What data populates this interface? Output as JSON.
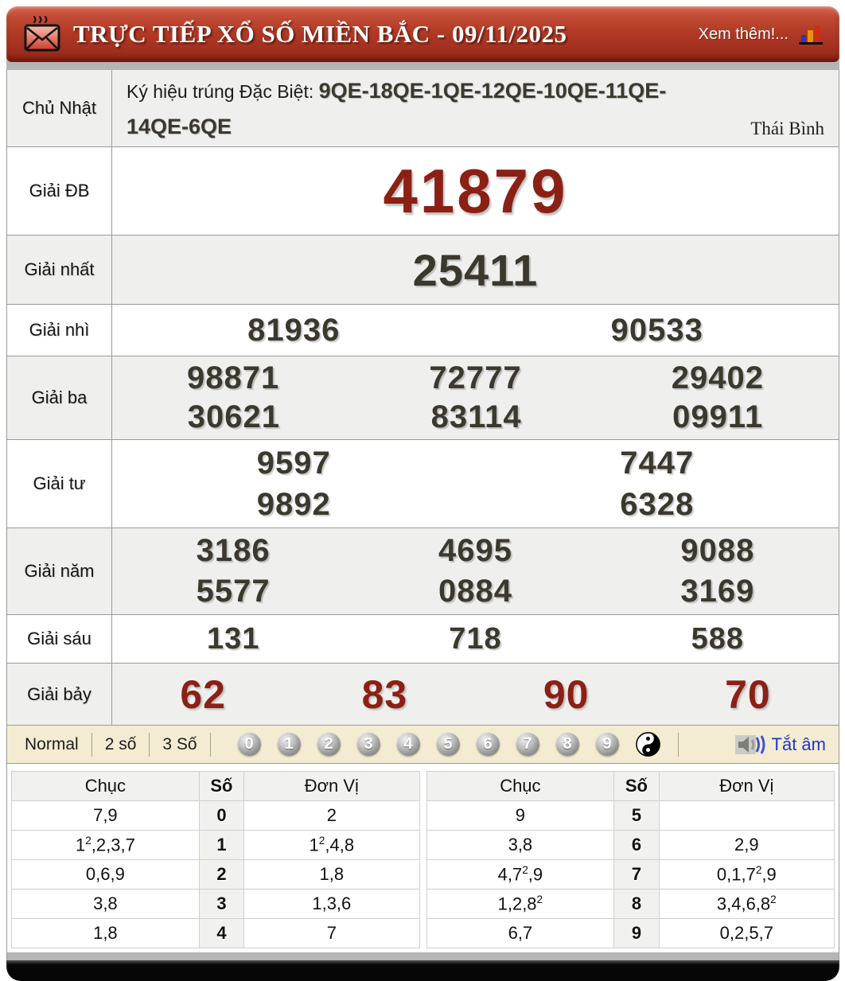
{
  "header": {
    "title": "TRỰC TIẾP XỔ SỐ MIỀN BẮC - 09/11/2025",
    "see_more": "Xem thêm!...",
    "icons": [
      "envelope-icon",
      "bar-chart-icon"
    ]
  },
  "info": {
    "day": "Chủ Nhật",
    "sign_label": "Ký hiệu trúng Đặc Biệt: ",
    "sign_codes": [
      "9QE-18QE-1QE-12QE-10QE-11QE-",
      "14QE-6QE"
    ],
    "sign_codes_full": "9QE-18QE-1QE-12QE-10QE-11QE-14QE-6QE",
    "province": "Thái Bình"
  },
  "prizes": [
    {
      "key": "db",
      "label": "Giải ĐB",
      "rows": [
        [
          "41879"
        ]
      ]
    },
    {
      "key": "nhat",
      "label": "Giải nhất",
      "rows": [
        [
          "25411"
        ]
      ]
    },
    {
      "key": "nhi",
      "label": "Giải nhì",
      "rows": [
        [
          "81936",
          "90533"
        ]
      ]
    },
    {
      "key": "ba",
      "label": "Giải ba",
      "rows": [
        [
          "98871",
          "72777",
          "29402"
        ],
        [
          "30621",
          "83114",
          "09911"
        ]
      ]
    },
    {
      "key": "tu",
      "label": "Giải tư",
      "rows": [
        [
          "9597",
          "7447"
        ],
        [
          "9892",
          "6328"
        ]
      ]
    },
    {
      "key": "nam",
      "label": "Giải năm",
      "rows": [
        [
          "3186",
          "4695",
          "9088"
        ],
        [
          "5577",
          "0884",
          "3169"
        ]
      ]
    },
    {
      "key": "sau",
      "label": "Giải sáu",
      "rows": [
        [
          "131",
          "718",
          "588"
        ]
      ]
    },
    {
      "key": "bay",
      "label": "Giải bảy",
      "rows": [
        [
          "62",
          "83",
          "90",
          "70"
        ]
      ]
    }
  ],
  "controls": {
    "modes": [
      "Normal",
      "2 số",
      "3 Số"
    ],
    "balls": [
      "0",
      "1",
      "2",
      "3",
      "4",
      "5",
      "6",
      "7",
      "8",
      "9"
    ],
    "yinyang_icon": "yin-yang-icon",
    "speaker_icon": "speaker-icon",
    "mute_label": "Tắt âm"
  },
  "digit_tables": [
    {
      "headers": [
        "Chục",
        "Số",
        "Đơn Vị"
      ],
      "rows": [
        [
          "7,9",
          "0",
          "2"
        ],
        [
          "1^2,2,3,7",
          "1",
          "1^2,4,8"
        ],
        [
          "0,6,9",
          "2",
          "1,8"
        ],
        [
          "3,8",
          "3",
          "1,3,6"
        ],
        [
          "1,8",
          "4",
          "7"
        ]
      ]
    },
    {
      "headers": [
        "Chục",
        "Số",
        "Đơn Vị"
      ],
      "rows": [
        [
          "9",
          "5",
          ""
        ],
        [
          "3,8",
          "6",
          "2,9"
        ],
        [
          "4,7^2,9",
          "7",
          "0,1,7^2,9"
        ],
        [
          "1,2,8^2",
          "8",
          "3,4,6,8^2"
        ],
        [
          "6,7",
          "9",
          "0,2,5,7"
        ]
      ]
    }
  ],
  "colors": {
    "accent_red": "#8b2015",
    "number_dark": "#3b382e",
    "control_bg": "#f3ecd2",
    "link_blue": "#2036c8",
    "row_alt": "#efefed",
    "header_red_top": "#d3664f",
    "header_red_bottom": "#8c2312"
  }
}
